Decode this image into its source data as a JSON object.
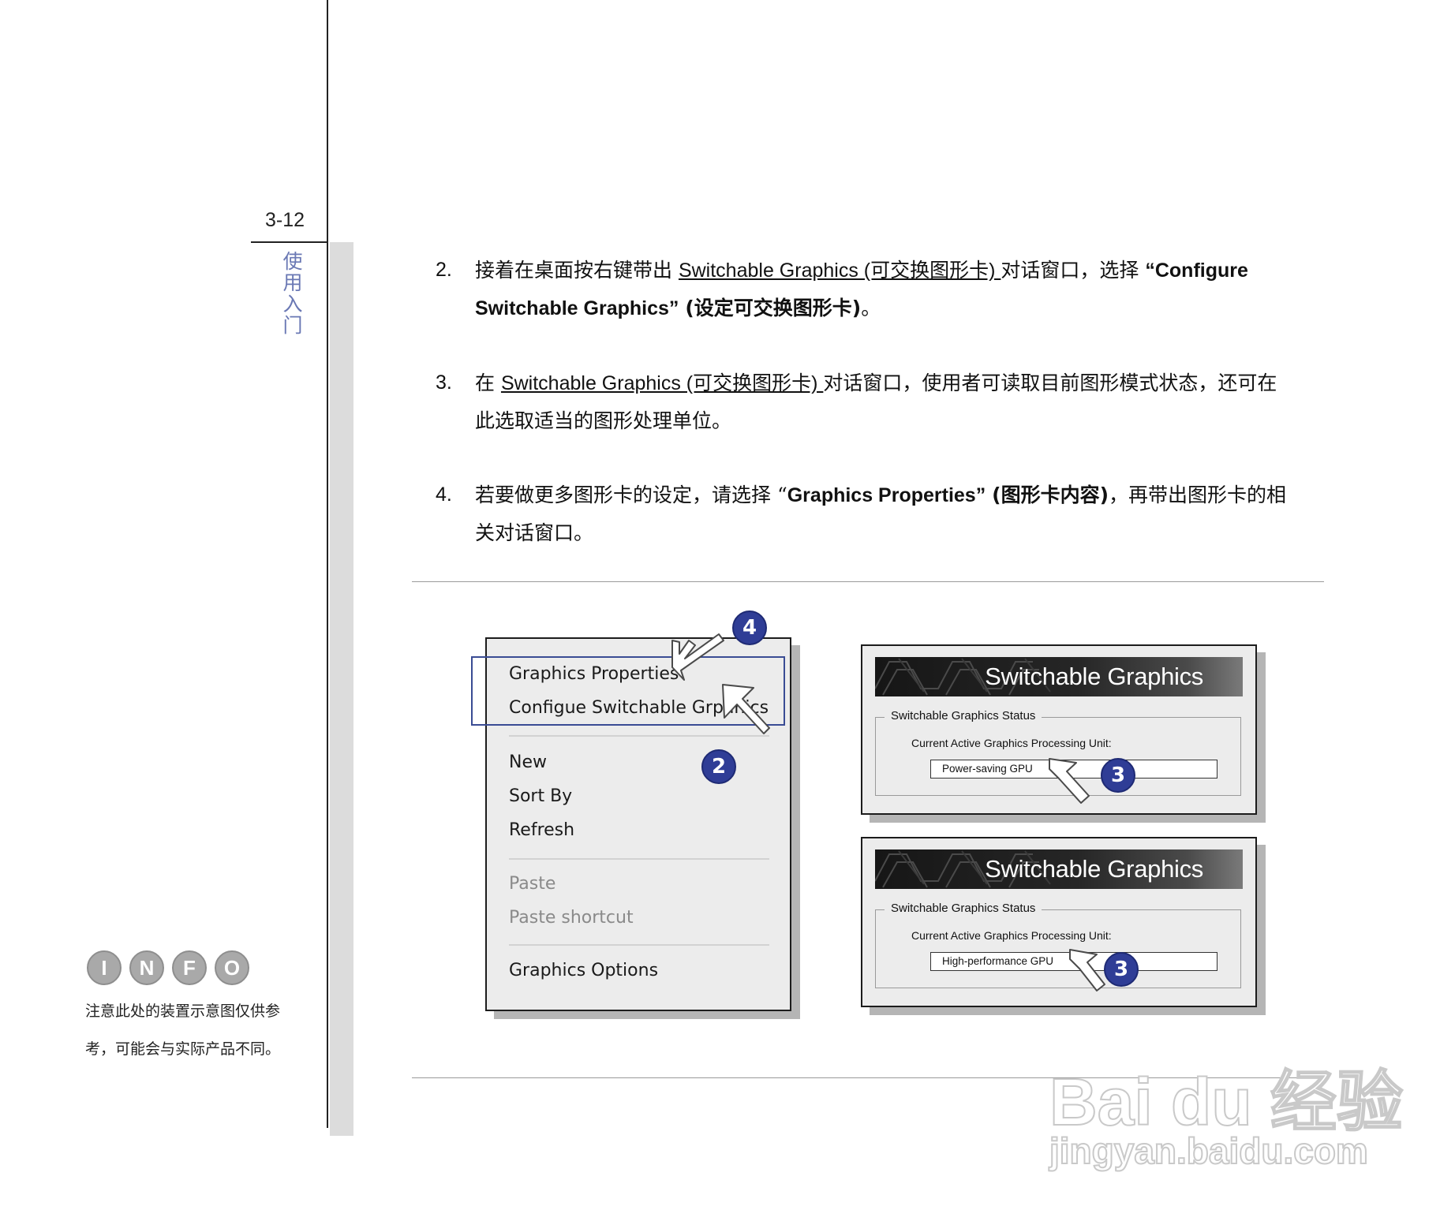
{
  "margin": {
    "page_number": "3-12",
    "chapter_chars": [
      "使",
      "用",
      "入",
      "门"
    ],
    "info_icons": [
      "I",
      "N",
      "F",
      "O"
    ],
    "note_line1": "注意此处的装置示意图仅供参",
    "note_line2": "考，可能会与实际产品不同。"
  },
  "steps": {
    "s2": {
      "num": "2.",
      "p1": "接着在桌面按右键带出 ",
      "link": "Switchable Graphics (可交换图形卡) ",
      "p2": "对话窗口，选择 ",
      "bold1": "“Configure",
      "bold2": "Switchable Graphics”",
      "bold3": "(设定可交换图形卡)",
      "p3": "。"
    },
    "s3": {
      "num": "3.",
      "p1": "在 ",
      "link": "Switchable Graphics (可交换图形卡) ",
      "p2": "对话窗口，使用者可读取目前图形模式状态，还可在",
      "p3": "此选取适当的图形处理单位。"
    },
    "s4": {
      "num": "4.",
      "p1": "若要做更多图形卡的设定，请选择 “",
      "bold1": "Graphics Properties”",
      "bold2": "(图形卡内容)",
      "p2": "，再带出图形卡的相",
      "p3": "关对话窗口。"
    }
  },
  "menu": {
    "items": [
      "Graphics Properties",
      "Configue Switchable Grpahics",
      "New",
      "Sort By",
      "Refresh",
      "Paste",
      "Paste shortcut",
      "Graphics Options"
    ]
  },
  "badges": {
    "four": "4",
    "two": "2",
    "three": "3"
  },
  "panels": [
    {
      "title": "Switchable Graphics",
      "group_label": "Switchable Graphics Status",
      "sub_label": "Current Active Graphics Processing Unit:",
      "value": "Power-saving GPU"
    },
    {
      "title": "Switchable Graphics",
      "group_label": "Switchable Graphics Status",
      "sub_label": "Current Active Graphics Processing Unit:",
      "value": "High-performance GPU"
    }
  ],
  "watermark": {
    "brand": "Bai du 经验",
    "url": "jingyan.baidu.com"
  },
  "colors": {
    "badge": "#2f3d96",
    "chapter": "#6a78b4",
    "highlight_border": "#3a4c94"
  }
}
